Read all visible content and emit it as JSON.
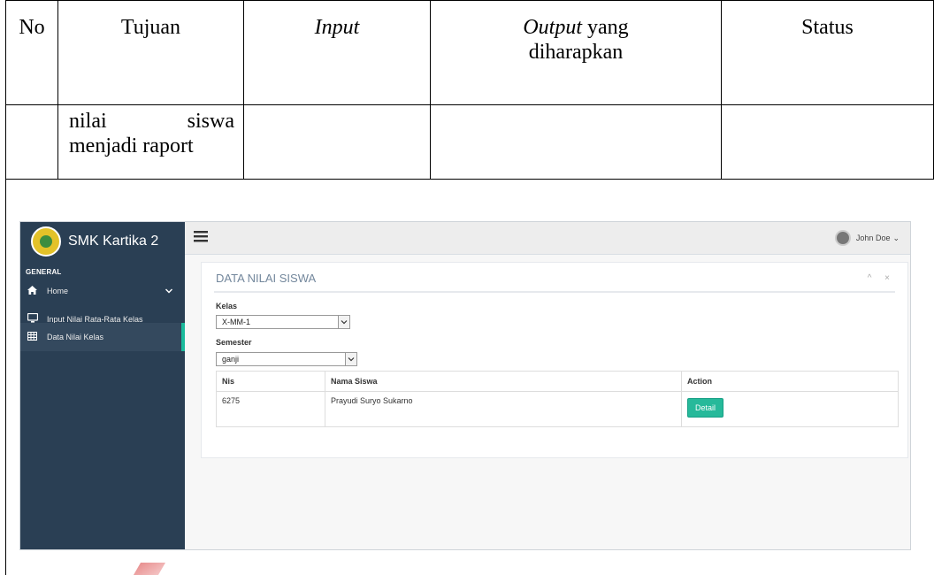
{
  "table": {
    "headers": {
      "no": "No",
      "tujuan": "Tujuan",
      "input": "Input",
      "output_italic": "Output",
      "output_rest": " yang",
      "output_line2": "diharapkan",
      "status": "Status"
    },
    "row": {
      "no": "",
      "tujuan_line1_a": "nilai",
      "tujuan_line1_b": "siswa",
      "tujuan_line2": "menjadi raport",
      "input": "",
      "output": "",
      "status": ""
    }
  },
  "app": {
    "brand": "SMK Kartika 2",
    "section_label": "GENERAL",
    "nav": {
      "home": "Home",
      "input_nilai": "Input Nilai Rata-Rata Kelas",
      "data_nilai": "Data Nilai Kelas"
    },
    "user_name": "John Doe",
    "user_caret": "⌄",
    "panel": {
      "title": "DATA NILAI SISWA",
      "tools": "^ ×",
      "kelas_label": "Kelas",
      "kelas_value": "X-MM-1",
      "semester_label": "Semester",
      "semester_value": "ganji",
      "columns": [
        "Nis",
        "Nama Siswa",
        "Action"
      ],
      "rows": [
        {
          "nis": "6275",
          "nama": "Prayudi Suryo Sukarno",
          "action": "Detail"
        }
      ]
    },
    "icons": {
      "hamburger": "hamburger-icon",
      "home": "home-icon",
      "monitor": "monitor-icon",
      "table": "table-icon"
    },
    "colors": {
      "sidebar": "#2a3f54",
      "accent": "#1abb9c",
      "button": "#26b99a"
    }
  }
}
